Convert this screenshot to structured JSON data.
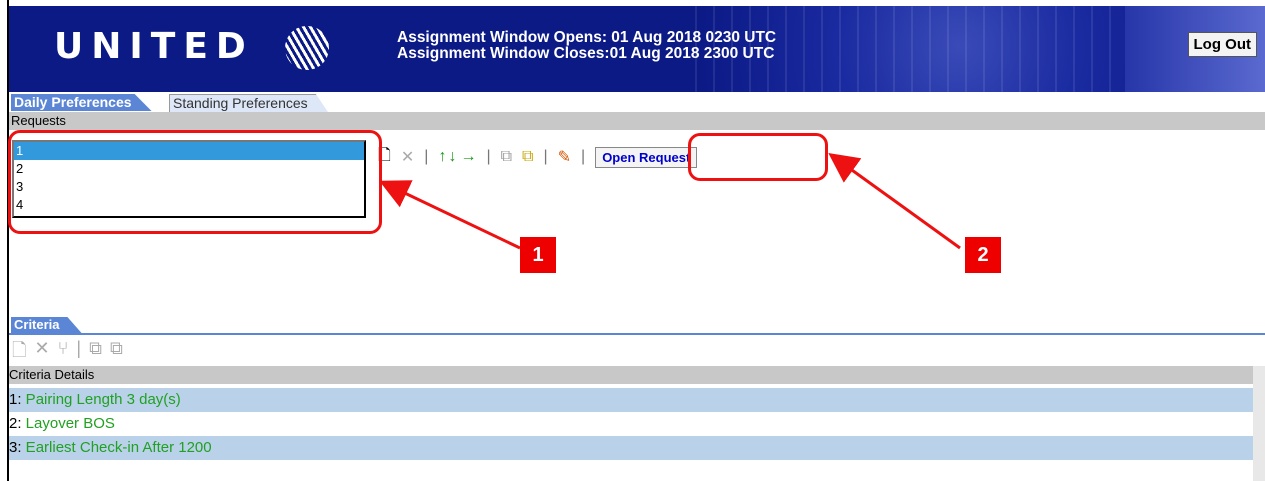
{
  "header": {
    "logo_text": "UNITED",
    "window_opens": "Assignment Window Opens: 01 Aug 2018 0230 UTC",
    "window_closes": "Assignment Window Closes:01 Aug 2018 2300 UTC",
    "logout_label": "Log Out"
  },
  "tabs": [
    {
      "label": "Daily Preferences",
      "active": true
    },
    {
      "label": "Standing Preferences",
      "active": false
    }
  ],
  "requests": {
    "header": "Requests",
    "items": [
      "1",
      "2",
      "3",
      "4"
    ],
    "selected": "1",
    "open_request_label": "Open Request"
  },
  "callouts": {
    "one": "1",
    "two": "2"
  },
  "criteria": {
    "tab_label": "Criteria",
    "details_header": "Criteria Details",
    "rows": [
      {
        "num": "1:",
        "text": " Pairing Length 3 day(s)"
      },
      {
        "num": "2:",
        "text": " Layover BOS"
      },
      {
        "num": "3:",
        "text": " Earliest Check-in After 1200"
      }
    ]
  },
  "colors": {
    "banner": "#0c1a86",
    "accent": "#5b86d6",
    "callout": "#ee1111",
    "criteria_text": "#22a022"
  }
}
